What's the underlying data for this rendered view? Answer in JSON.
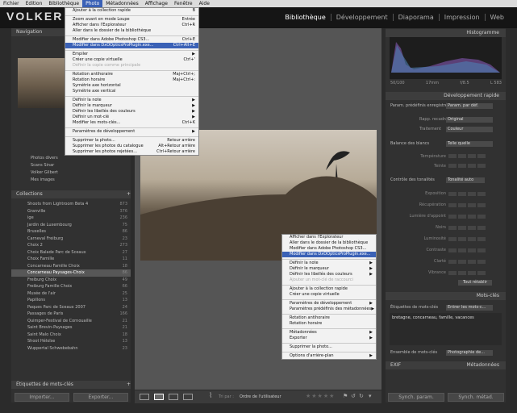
{
  "menubar": {
    "items": [
      "Fichier",
      "Edition",
      "Bibliothèque",
      "Photo",
      "Métadonnées",
      "Affichage",
      "Fenêtre",
      "Aide"
    ],
    "active_index": 3
  },
  "brand": "VOLKER G",
  "modules": [
    "Bibliothèque",
    "Développement",
    "Diaporama",
    "Impression",
    "Web"
  ],
  "left": {
    "navigator": "Navigation",
    "folders": [
      {
        "label": "Photos divers"
      },
      {
        "label": "Scans Sinar"
      },
      {
        "label": "Volker Gilbert"
      },
      {
        "label": "Mes images"
      }
    ],
    "collections_title": "Collections",
    "collections": [
      {
        "label": "Shoots from Lightroom Beta 4",
        "count": "873"
      },
      {
        "label": "Granville",
        "count": "376"
      },
      {
        "label": "ige",
        "count": "236"
      },
      {
        "label": "Jardin de Luxembourg",
        "count": "75"
      },
      {
        "label": "Bruxelles",
        "count": "86"
      },
      {
        "label": "Carneval Freiburg",
        "count": "23"
      },
      {
        "label": "Choix 2",
        "count": "273"
      },
      {
        "label": "Choix Balade Parc de Sceaux",
        "count": "27"
      },
      {
        "label": "Choix Famille",
        "count": "11"
      },
      {
        "label": "Concarneau Famille Choix",
        "count": "18"
      },
      {
        "label": "Concarneau Paysages-Choix",
        "count": "86"
      },
      {
        "label": "Freiburg Choix",
        "count": "49"
      },
      {
        "label": "Freiburg Famille Choix",
        "count": "66"
      },
      {
        "label": "Musée de l'air",
        "count": "25"
      },
      {
        "label": "Papillons",
        "count": "13"
      },
      {
        "label": "Paques Parc de Sceaux 2007",
        "count": "24"
      },
      {
        "label": "Passages de Paris",
        "count": "166"
      },
      {
        "label": "Quimper-Festival de Cornouaille",
        "count": "21"
      },
      {
        "label": "Saint Brevin-Paysages",
        "count": "21"
      },
      {
        "label": "Saint Malo Choix",
        "count": "18"
      },
      {
        "label": "Shoot Héloïse",
        "count": "13"
      },
      {
        "label": "Wuppertal Schwebebahn",
        "count": "23"
      }
    ],
    "selected_index": 10,
    "keywords_title": "Étiquettes de mots-clés",
    "import_label": "Importer...",
    "export_label": "Exporter..."
  },
  "photo_menu": [
    {
      "label": "Ajouter à la collection rapide",
      "shortcut": "B"
    },
    {
      "sep": true
    },
    {
      "label": "Zoom avant en mode Loupe",
      "shortcut": "Entrée"
    },
    {
      "label": "Afficher dans l'Explorateur",
      "shortcut": "Ctrl+R"
    },
    {
      "label": "Aller dans le dossier de la bibliothèque",
      "shortcut": ""
    },
    {
      "sep": true
    },
    {
      "label": "Modifier dans Adobe Photoshop CS3...",
      "shortcut": "Ctrl+E"
    },
    {
      "label": "Modifier dans DxOOpticsProPlugin.exe...",
      "shortcut": "Ctrl+Alt+E",
      "hl": true
    },
    {
      "sep": true
    },
    {
      "label": "Empiler",
      "shortcut": "",
      "sub": true
    },
    {
      "label": "Créer une copie virtuelle",
      "shortcut": "Ctrl+'"
    },
    {
      "label": "Définir la copie comme principale",
      "shortcut": "",
      "dis": true
    },
    {
      "sep": true
    },
    {
      "label": "Rotation antihoraire",
      "shortcut": "Maj+Ctrl+;"
    },
    {
      "label": "Rotation horaire",
      "shortcut": "Maj+Ctrl+:"
    },
    {
      "label": "Symétrie axe horizontal",
      "shortcut": ""
    },
    {
      "label": "Symétrie axe vertical",
      "shortcut": ""
    },
    {
      "sep": true
    },
    {
      "label": "Définir la note",
      "shortcut": "",
      "sub": true
    },
    {
      "label": "Définir le marqueur",
      "shortcut": "",
      "sub": true
    },
    {
      "label": "Définir les libellés des couleurs",
      "shortcut": "",
      "sub": true
    },
    {
      "label": "Définir un mot-clé",
      "shortcut": "",
      "sub": true
    },
    {
      "label": "Modifier les mots-clés...",
      "shortcut": "Ctrl+K"
    },
    {
      "sep": true
    },
    {
      "label": "Paramètres de développement",
      "shortcut": "",
      "sub": true
    },
    {
      "sep": true
    },
    {
      "label": "Supprimer la photo...",
      "shortcut": "Retour arrière"
    },
    {
      "label": "Supprimer les photos du catalogue",
      "shortcut": "Alt+Retour arrière"
    },
    {
      "label": "Supprimer les photos rejetées...",
      "shortcut": "Ctrl+Retour arrière"
    }
  ],
  "context_menu": [
    {
      "label": "Afficher dans l'Explorateur"
    },
    {
      "label": "Aller dans le dossier de la bibliothèque"
    },
    {
      "label": "Modifier dans Adobe Photoshop CS3..."
    },
    {
      "label": "Modifier dans DxOOpticsProPlugin.exe...",
      "hl": true
    },
    {
      "sep": true
    },
    {
      "label": "Définir la note",
      "sub": true
    },
    {
      "label": "Définir le marqueur",
      "sub": true
    },
    {
      "label": "Définir les libellés des couleurs",
      "sub": true
    },
    {
      "label": "Ajouter un mot-clé de raccourci",
      "dis": true
    },
    {
      "sep": true
    },
    {
      "label": "Ajouter à la collection rapide"
    },
    {
      "label": "Créer une copie virtuelle"
    },
    {
      "sep": true
    },
    {
      "label": "Paramètres de développement",
      "sub": true
    },
    {
      "label": "Paramètres prédéfinis des métadonnées",
      "sub": true
    },
    {
      "sep": true
    },
    {
      "label": "Rotation antihoraire"
    },
    {
      "label": "Rotation horaire"
    },
    {
      "sep": true
    },
    {
      "label": "Métadonnées",
      "sub": true
    },
    {
      "label": "Exporter",
      "sub": true
    },
    {
      "sep": true
    },
    {
      "label": "Supprimer la photo..."
    },
    {
      "sep": true
    },
    {
      "label": "Options d'arrière-plan",
      "sub": true
    }
  ],
  "toolbar": {
    "sort_label": "Tri par :",
    "sort_value": "Ordre de l'utilisateur"
  },
  "right": {
    "histogram_title": "Histogramme",
    "histo_info": [
      "50/100",
      "17mm",
      "f/8.5",
      "L 583"
    ],
    "quick_dev_title": "Développement rapide",
    "preset_label": "Param. prédéfinis enregistrés",
    "preset_value": "Param. par déf.",
    "crop_label": "Rapp. recadrage",
    "crop_value": "Original",
    "treat_label": "Traitement",
    "treat_value": "Couleur",
    "wb_label": "Balance des blancs",
    "wb_value": "Telle quelle",
    "temp_label": "Température",
    "tint_label": "Teinte",
    "tone_label": "Contrôle des tonalités",
    "tone_value": "Tonalité auto",
    "sliders": [
      "Exposition",
      "Récupération",
      "Lumière d'appoint",
      "Noirs",
      "Luminosité",
      "Contraste",
      "Clarté",
      "Vibrance"
    ],
    "reset_label": "Tout rétablir",
    "keywords_title": "Mots-clés",
    "kw_label": "Étiquettes de mots-clés",
    "kw_value": "Entrer les mots-c...",
    "kw_text": "bretagne, concarneau, famille, vacances",
    "kwset_label": "Ensemble de mots-clés",
    "kwset_value": "Photographie de...",
    "meta_title": "Métadonnées",
    "meta_value": "EXIF",
    "sync_params": "Synch. param.",
    "sync_meta": "Synch. métad."
  }
}
